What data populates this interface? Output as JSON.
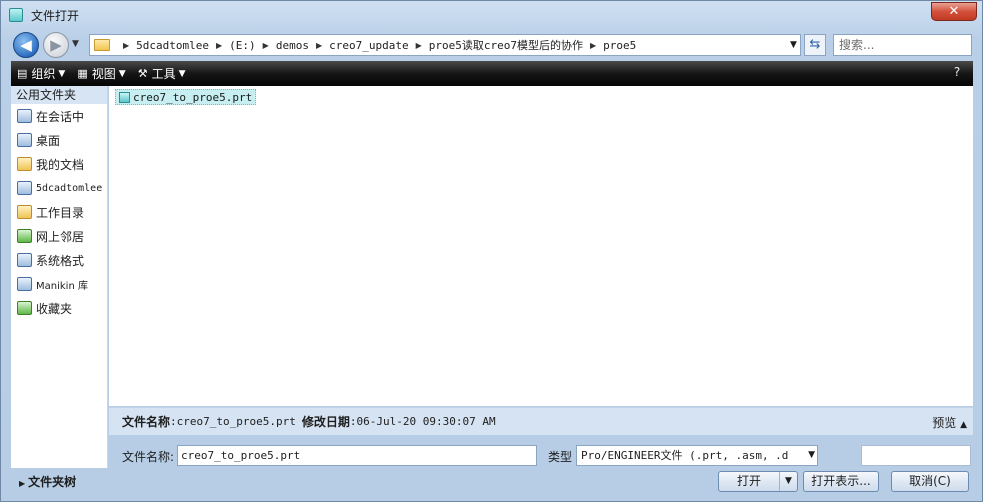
{
  "window": {
    "title": "文件打开",
    "close_label": "✕"
  },
  "nav": {
    "back_glyph": "◀",
    "forward_glyph": "▶",
    "breadcrumbs": [
      "5dcadtomlee",
      "(E:)",
      "demos",
      "creo7_update",
      "proe5读取creo7模型后的协作",
      "proe5"
    ],
    "search_placeholder": "搜索..."
  },
  "toolbar": {
    "organize": "组织",
    "views": "视图",
    "tools": "工具"
  },
  "sidebar": {
    "header": "公用文件夹",
    "items": [
      {
        "label": "在会话中",
        "icon": "session-icon"
      },
      {
        "label": "桌面",
        "icon": "desktop-icon"
      },
      {
        "label": "我的文档",
        "icon": "documents-icon"
      },
      {
        "label": "5dcadtomlee",
        "icon": "computer-icon"
      },
      {
        "label": "工作目录",
        "icon": "working-dir-icon"
      },
      {
        "label": "网上邻居",
        "icon": "network-icon"
      },
      {
        "label": "系统格式",
        "icon": "system-format-icon"
      },
      {
        "label": "Manikin 库",
        "icon": "manikin-library-icon"
      },
      {
        "label": "收藏夹",
        "icon": "favorites-icon"
      }
    ],
    "folder_tree": "文件夹树"
  },
  "files": [
    {
      "name": "creo7_to_proe5.prt"
    }
  ],
  "details": {
    "name_label": "文件名称",
    "name_value": ":creo7_to_proe5.prt",
    "date_label": "修改日期",
    "date_value": ":06-Jul-20 09:30:07 AM",
    "preview": "预览"
  },
  "bottom": {
    "filename_label": "文件名称:",
    "filename_value": "creo7_to_proe5.prt",
    "type_label": "类型",
    "type_value": "Pro/ENGINEER文件 (.prt, .asm, .d",
    "open": "打开",
    "open_as": "打开表示...",
    "cancel": "取消(C)"
  }
}
